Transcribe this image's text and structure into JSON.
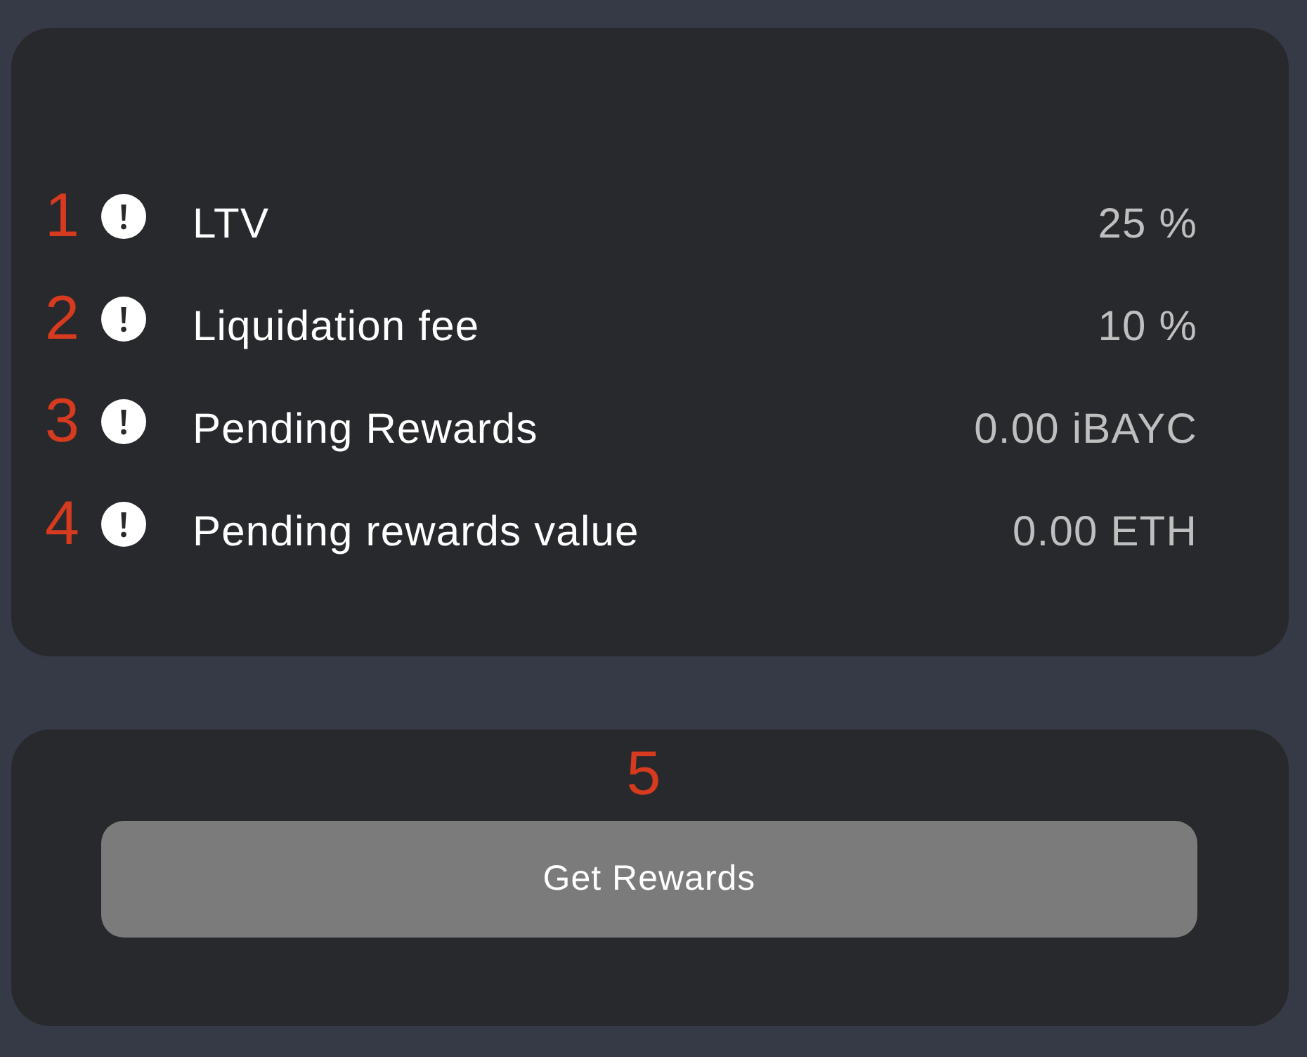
{
  "details": {
    "rows": [
      {
        "marker": "1",
        "label": "LTV",
        "value": "25 %"
      },
      {
        "marker": "2",
        "label": "Liquidation fee",
        "value": "10 %"
      },
      {
        "marker": "3",
        "label": "Pending Rewards",
        "value": "0.00 iBAYC"
      },
      {
        "marker": "4",
        "label": "Pending rewards value",
        "value": "0.00 ETH"
      }
    ]
  },
  "rewards": {
    "marker": "5",
    "button": {
      "label": "Get Rewards",
      "disabled": true
    }
  }
}
